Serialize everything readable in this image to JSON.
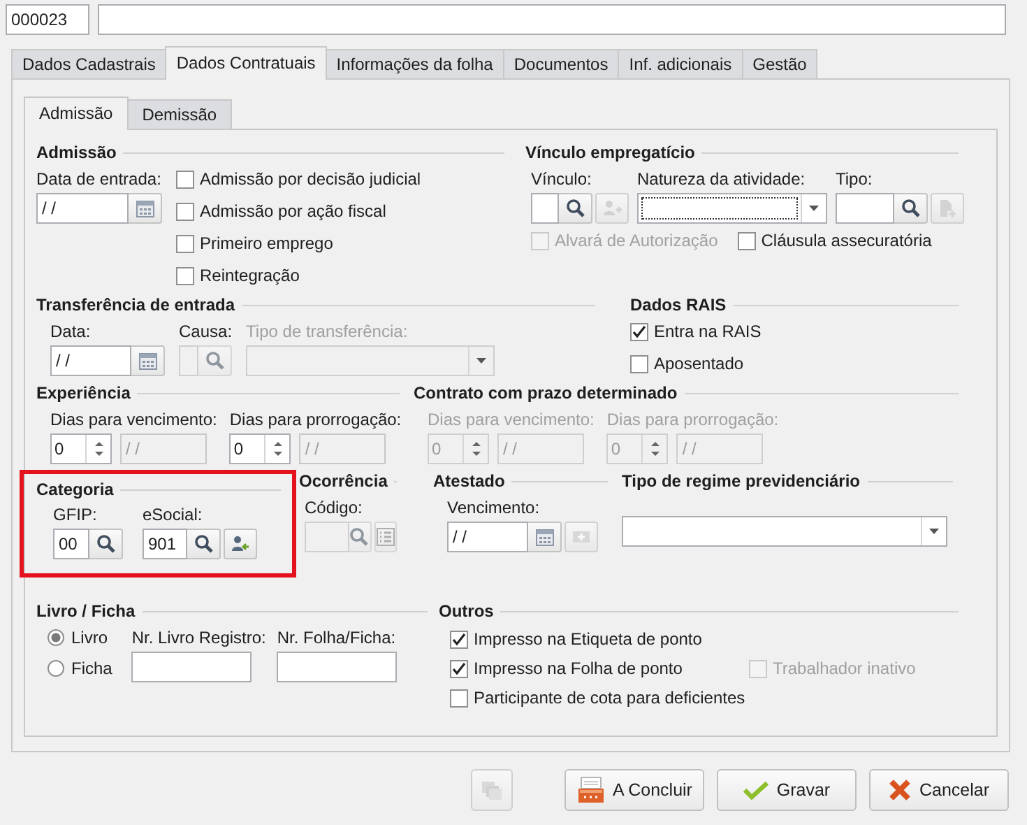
{
  "header": {
    "code": "000023"
  },
  "tabs": [
    {
      "label": "Dados Cadastrais",
      "selected": false
    },
    {
      "label": "Dados Contratuais",
      "selected": true
    },
    {
      "label": "Informações da folha",
      "selected": false
    },
    {
      "label": "Documentos",
      "selected": false
    },
    {
      "label": "Inf. adicionais",
      "selected": false
    },
    {
      "label": "Gestão",
      "selected": false
    }
  ],
  "subtabs": [
    {
      "label": "Admissão",
      "selected": true
    },
    {
      "label": "Demissão",
      "selected": false
    }
  ],
  "admissao": {
    "title": "Admissão",
    "date_label": "Data de entrada:",
    "date_value": "/ /",
    "checkboxes": [
      {
        "label": "Admissão por decisão judicial",
        "checked": false,
        "disabled": false
      },
      {
        "label": "Admissão por ação fiscal",
        "checked": false,
        "disabled": false
      },
      {
        "label": "Primeiro emprego",
        "checked": false,
        "disabled": false
      },
      {
        "label": "Reintegração",
        "checked": false,
        "disabled": false
      }
    ]
  },
  "vinculo": {
    "title": "Vínculo empregatício",
    "vinculo_label": "Vínculo:",
    "natureza_label": "Natureza da atividade:",
    "tipo_label": "Tipo:",
    "checkboxes": [
      {
        "label": "Alvará de Autorização",
        "checked": false,
        "disabled": true
      },
      {
        "label": "Cláusula assecuratória",
        "checked": false,
        "disabled": false
      }
    ]
  },
  "transferencia": {
    "title": "Transferência de entrada",
    "data_label": "Data:",
    "data_value": "/ /",
    "causa_label": "Causa:",
    "tipo_label": "Tipo de transferência:",
    "disabled": true
  },
  "rais": {
    "title": "Dados RAIS",
    "checkboxes": [
      {
        "label": "Entra na RAIS",
        "checked": true,
        "disabled": false
      },
      {
        "label": "Aposentado",
        "checked": false,
        "disabled": false
      }
    ]
  },
  "experiencia": {
    "title": "Experiência",
    "fields": [
      {
        "label": "Dias para vencimento:",
        "value": "0",
        "date": "/ /",
        "disabled": false
      },
      {
        "label": "Dias para prorrogação:",
        "value": "0",
        "date": "/ /",
        "disabled": false
      }
    ]
  },
  "contrato": {
    "title": "Contrato com prazo determinado",
    "fields": [
      {
        "label": "Dias para vencimento:",
        "value": "0",
        "date": "/ /",
        "disabled": true
      },
      {
        "label": "Dias para prorrogação:",
        "value": "0",
        "date": "/ /",
        "disabled": true
      }
    ]
  },
  "categoria": {
    "title": "Categoria",
    "highlighted": true,
    "gfip_label": "GFIP:",
    "gfip_value": "00",
    "esocial_label": "eSocial:",
    "esocial_value": "901"
  },
  "ocorrencia": {
    "title": "Ocorrência",
    "codigo_label": "Código:"
  },
  "atestado": {
    "title": "Atestado",
    "vencimento_label": "Vencimento:",
    "vencimento_value": "/ /"
  },
  "regime": {
    "title": "Tipo de regime previdenciário"
  },
  "livro": {
    "title": "Livro / Ficha",
    "options": [
      {
        "label": "Livro",
        "selected": true
      },
      {
        "label": "Ficha",
        "selected": false
      }
    ],
    "registro_label": "Nr. Livro Registro:",
    "folha_label": "Nr. Folha/Ficha:"
  },
  "outros": {
    "title": "Outros",
    "checkboxes": [
      {
        "label": "Impresso na Etiqueta de ponto",
        "checked": true,
        "disabled": false
      },
      {
        "label": "Impresso na Folha de ponto",
        "checked": true,
        "disabled": false
      },
      {
        "label": "Trabalhador inativo",
        "checked": false,
        "disabled": true
      },
      {
        "label": "Participante de cota para deficientes",
        "checked": false,
        "disabled": false
      }
    ]
  },
  "buttons": [
    {
      "label": "A Concluir",
      "kind": "conclude"
    },
    {
      "label": "Gravar",
      "kind": "save"
    },
    {
      "label": "Cancelar",
      "kind": "cancel"
    }
  ]
}
